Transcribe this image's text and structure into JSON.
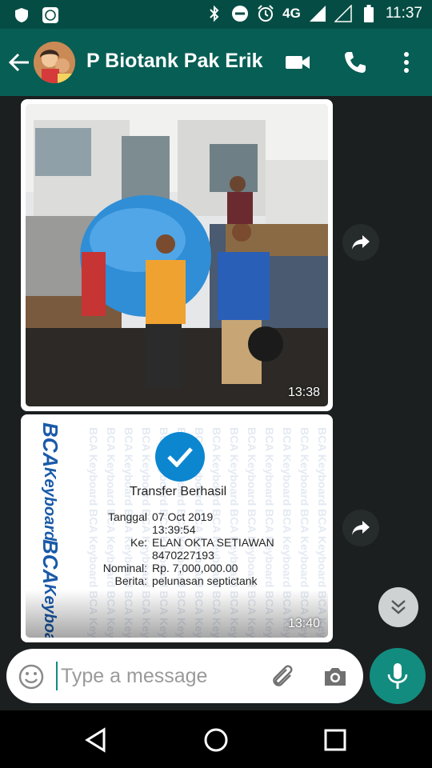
{
  "status_bar": {
    "network": "4G",
    "time": "11:37",
    "icons": [
      "shield-icon",
      "notification-app-icon",
      "bluetooth-icon",
      "do-not-disturb-icon",
      "alarm-icon",
      "signal-icon",
      "signal-empty-icon",
      "battery-icon"
    ]
  },
  "header": {
    "contact_name": "P Biotank Pak Erik",
    "icons": [
      "back-arrow-icon",
      "video-call-icon",
      "phone-call-icon",
      "more-options-icon"
    ]
  },
  "messages": [
    {
      "type": "image",
      "time": "13:38",
      "description_icon": "forward-icon"
    },
    {
      "type": "image",
      "time": "13:40",
      "receipt": {
        "brand_watermark_1": "BCA",
        "brand_watermark_2": "Keyboard",
        "title": "Transfer Berhasil",
        "rows": [
          {
            "label": "Tanggal",
            "value": "07 Oct 2019"
          },
          {
            "label": "",
            "value": "13:39:54"
          },
          {
            "label": "Ke:",
            "value": "ELAN OKTA SETIAWAN"
          },
          {
            "label": "",
            "value": "8470227193"
          },
          {
            "label": "Nominal:",
            "value": "Rp. 7,000,000.00"
          },
          {
            "label": "Berita:",
            "value": "pelunasan septictank"
          }
        ]
      }
    }
  ],
  "composer": {
    "placeholder": "Type a message"
  },
  "colors": {
    "header_green": "#075e54",
    "accent_teal": "#128c7e",
    "check_blue": "#0d86d0",
    "chat_bg": "#1b1f20"
  }
}
